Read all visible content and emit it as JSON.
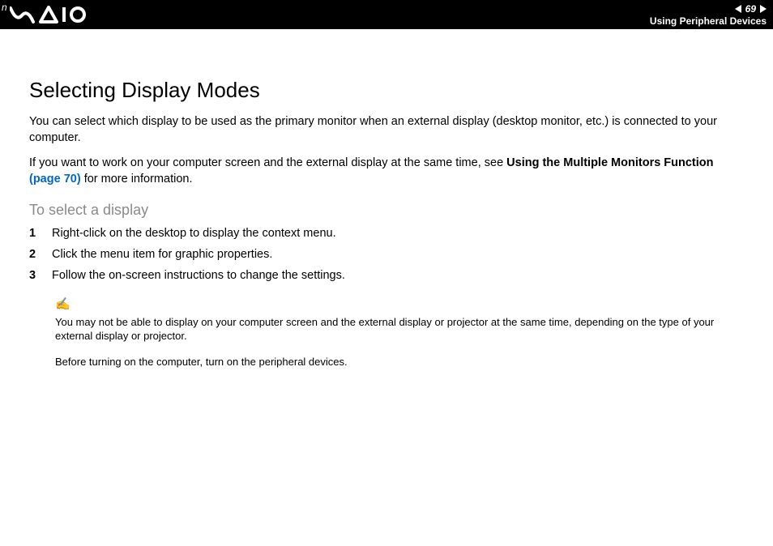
{
  "header": {
    "n_label": "n",
    "page_number": "69",
    "section": "Using Peripheral Devices"
  },
  "title": "Selecting Display Modes",
  "paragraph1": "You can select which display to be used as the primary monitor when an external display (desktop monitor, etc.) is connected to your computer.",
  "paragraph2_a": "If you want to work on your computer screen and the external display at the same time, see ",
  "paragraph2_bold": "Using the Multiple Monitors Function",
  "paragraph2_link": " (page 70)",
  "paragraph2_b": " for more information.",
  "subhead": "To select a display",
  "steps": [
    "Right-click on the desktop to display the context menu.",
    "Click the menu item for graphic properties.",
    "Follow the on-screen instructions to change the settings."
  ],
  "note1": "You may not be able to display on your computer screen and the external display or projector at the same time, depending on the type of your external display or projector.",
  "note2": "Before turning on the computer, turn on the peripheral devices."
}
